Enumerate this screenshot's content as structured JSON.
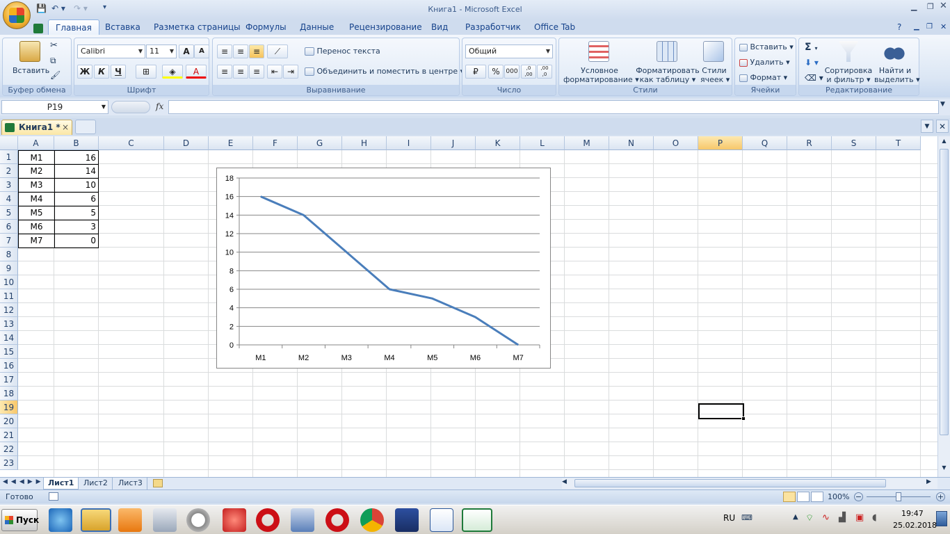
{
  "window": {
    "title": "Книга1 - Microsoft Excel"
  },
  "ribbon_tabs": [
    "Главная",
    "Вставка",
    "Разметка страницы",
    "Формулы",
    "Данные",
    "Рецензирование",
    "Вид",
    "Разработчик",
    "Office Tab"
  ],
  "ribbon": {
    "clipboard": {
      "paste": "Вставить",
      "label": "Буфер обмена"
    },
    "font": {
      "name": "Calibri",
      "size": "11",
      "bold": "Ж",
      "italic": "К",
      "underline": "Ч",
      "grow": "A",
      "shrink": "A",
      "color": "A",
      "label": "Шрифт"
    },
    "alignment": {
      "wrap": "Перенос текста",
      "merge": "Объединить и поместить в центре",
      "label": "Выравнивание"
    },
    "number": {
      "format": "Общий",
      "percent": "%",
      "thousands": "000",
      "inc": ",0 ,00",
      "dec": ",00 ,0",
      "label": "Число"
    },
    "styles": {
      "cond": "Условное",
      "cond2": "форматирование",
      "table": "Форматировать",
      "table2": "как таблицу",
      "cell": "Стили",
      "cell2": "ячеек",
      "label": "Стили"
    },
    "cells": {
      "insert": "Вставить",
      "delete": "Удалить",
      "format": "Формат",
      "label": "Ячейки"
    },
    "editing": {
      "sigma": "Σ",
      "sort": "Сортировка",
      "sort2": "и фильтр",
      "find": "Найти и",
      "find2": "выделить",
      "label": "Редактирование"
    }
  },
  "formula_bar": {
    "name_box": "P19",
    "fx": "fx",
    "formula": ""
  },
  "doc_tab": {
    "label": "Книга1 *",
    "close": "×"
  },
  "columns": [
    "A",
    "B",
    "C",
    "D",
    "E",
    "F",
    "G",
    "H",
    "I",
    "J",
    "K",
    "L",
    "M",
    "N",
    "O",
    "P",
    "Q",
    "R",
    "S",
    "T"
  ],
  "rows": [
    "1",
    "2",
    "3",
    "4",
    "5",
    "6",
    "7",
    "8",
    "9",
    "10",
    "11",
    "12",
    "13",
    "14",
    "15",
    "16",
    "17",
    "18",
    "19",
    "20",
    "21",
    "22",
    "23"
  ],
  "table": {
    "labels": [
      "M1",
      "M2",
      "M3",
      "M4",
      "M5",
      "M6",
      "M7"
    ],
    "values": [
      "16",
      "14",
      "10",
      "6",
      "5",
      "3",
      "0"
    ]
  },
  "selected_cell": "P19",
  "chart_data": {
    "type": "line",
    "categories": [
      "M1",
      "M2",
      "M3",
      "M4",
      "M5",
      "M6",
      "M7"
    ],
    "values": [
      16,
      14,
      10,
      6,
      5,
      3,
      0
    ],
    "ylim": [
      0,
      18
    ],
    "yticks": [
      "0",
      "2",
      "4",
      "6",
      "8",
      "10",
      "12",
      "14",
      "16",
      "18"
    ],
    "title": "",
    "xlabel": "",
    "ylabel": "",
    "grid": true,
    "line_color": "#4a7ebb"
  },
  "sheet_tabs": [
    "Лист1",
    "Лист2",
    "Лист3"
  ],
  "status": {
    "ready": "Готово",
    "zoom": "100%"
  },
  "taskbar": {
    "start": "Пуск",
    "lang": "RU",
    "time": "19:47",
    "date": "25.02.2018"
  }
}
